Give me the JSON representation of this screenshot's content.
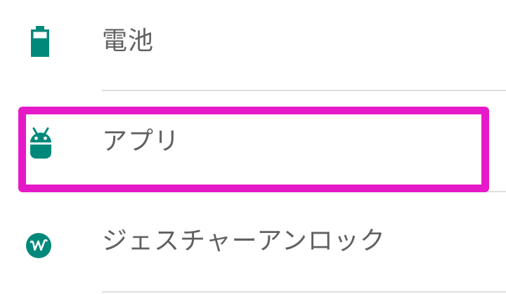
{
  "settings": {
    "items": [
      {
        "label": "電池",
        "icon": "battery-icon"
      },
      {
        "label": "アプリ",
        "icon": "android-icon"
      },
      {
        "label": "ジェスチャーアンロック",
        "icon": "gesture-w-icon"
      }
    ]
  },
  "colors": {
    "icon_teal": "#00897b",
    "label_text": "#616161",
    "divider": "#e0e0e0",
    "highlight": "#e619c8"
  }
}
